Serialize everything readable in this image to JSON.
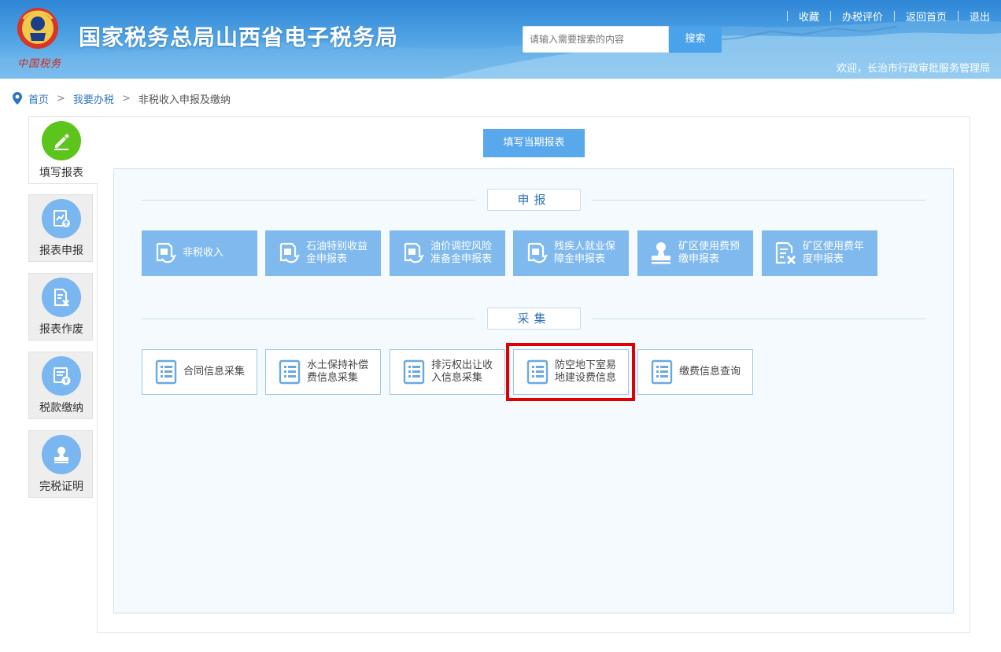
{
  "header": {
    "title": "国家税务总局山西省电子税务局",
    "logo_text": "中国税务",
    "search_placeholder": "请输入需要搜索的内容",
    "search_button": "搜索",
    "links": [
      "收藏",
      "办税评价",
      "返回首页",
      "退出"
    ],
    "welcome": "欢迎，长治市行政审批服务管理局"
  },
  "breadcrumb": {
    "home": "首页",
    "level1": "我要办税",
    "current": "非税收入申报及缴纳",
    "separator": ">"
  },
  "sidebar": {
    "items": [
      {
        "label": "填写报表",
        "icon": "pencil-icon",
        "active": true
      },
      {
        "label": "报表申报",
        "icon": "report-upload-icon",
        "active": false
      },
      {
        "label": "报表作废",
        "icon": "report-void-icon",
        "active": false
      },
      {
        "label": "税款缴纳",
        "icon": "tax-payment-icon",
        "active": false
      },
      {
        "label": "完税证明",
        "icon": "stamp-icon",
        "active": false
      }
    ]
  },
  "main": {
    "fill_button": "填写当期报表",
    "declare_section": {
      "title": "申报",
      "tiles": [
        {
          "label": "非税收入",
          "icon": "declare-doc-icon"
        },
        {
          "label": "石油特别收益金申报表",
          "icon": "declare-doc-icon"
        },
        {
          "label": "油价调控风险准备金申报表",
          "icon": "declare-doc-icon"
        },
        {
          "label": "残疾人就业保障金申报表",
          "icon": "declare-doc-icon"
        },
        {
          "label": "矿区使用费预缴申报表",
          "icon": "stamp-icon"
        },
        {
          "label": "矿区使用费年度申报表",
          "icon": "doc-cancel-icon"
        }
      ]
    },
    "collect_section": {
      "title": "采集",
      "tiles": [
        {
          "label": "合同信息采集",
          "icon": "list-doc-icon"
        },
        {
          "label": "水土保持补偿费信息采集",
          "icon": "list-doc-icon"
        },
        {
          "label": "排污权出让收入信息采集",
          "icon": "list-doc-icon"
        },
        {
          "label": "防空地下室易地建设费信息",
          "icon": "list-doc-icon",
          "highlighted": true
        },
        {
          "label": "缴费信息查询",
          "icon": "list-doc-icon"
        }
      ]
    }
  },
  "colors": {
    "header_blue": "#3a92dc",
    "tile_blue": "#7fb9ee",
    "active_green": "#5cc41a",
    "link_blue": "#2f74c0",
    "highlight_red": "#e00000"
  }
}
